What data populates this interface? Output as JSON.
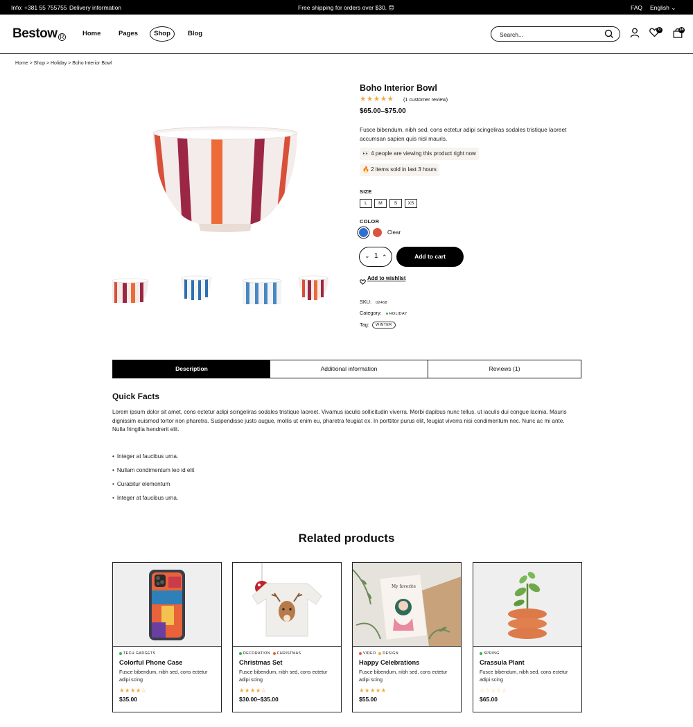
{
  "topbar": {
    "info": "Info: +381 55 755755",
    "delivery": "Delivery information",
    "shipping": "Free shipping for orders over $30. 😊",
    "faq": "FAQ",
    "language": "English ⌄"
  },
  "header": {
    "logo": "Bestow",
    "logo_mark": "R",
    "nav": [
      "Home",
      "Pages",
      "Shop",
      "Blog"
    ],
    "search_placeholder": "Search...",
    "wishlist_count": "0",
    "cart_count": "24"
  },
  "breadcrumb": "Home > Shop > Holiday > Boho Interior Bowl",
  "product": {
    "title": "Boho Interior Bowl",
    "stars": "★★★★★",
    "rating": 5,
    "review_text": "(1 customer review)",
    "price": "$65.00–$75.00",
    "description": "Fusce bibendum, nibh sed, cons ectetur adipi scingeliras sodales tristique laoreet accumsan sapien quis nisl mauris.",
    "viewing": "👀 4 people are viewing this product right now",
    "sold": "🔥 2 items sold in last 3 hours",
    "size_label": "SIZE",
    "sizes": [
      "L",
      "M",
      "S",
      "XS"
    ],
    "color_label": "COLOR",
    "colors": [
      "#2f6fd1",
      "#d9553d"
    ],
    "clear_label": "Clear",
    "quantity": "1",
    "add_to_cart": "Add to cart",
    "wishlist": "Add to wishlist",
    "sku_label": "SKU:",
    "sku": "02468",
    "category_label": "Category:",
    "category": "HOLIDAY",
    "tag_label": "Tag:",
    "tag": "WINTER"
  },
  "tabs": [
    "Description",
    "Additional information",
    "Reviews (1)"
  ],
  "quick_facts": {
    "title": "Quick Facts",
    "text": "Lorem ipsum dolor sit amet, cons ectetur adipi scingeliras sodales tristique laoreet. Vivamus iaculis sollicitudin viverra. Morbi dapibus nunc tellus, ut iaculis dui congue lacinia. Mauris dignissim euismod tortor non pharetra. Suspendisse justo augue, mollis ut enim eu, pharetra feugiat ex. In porttitor purus elit, feugiat viverra nisi condimentum nec. Nunc ac mi ante. Nulla fringilla hendrerit elit.",
    "bullets": [
      "Integer at faucibus urna.",
      "Nullam condimentum leo id elit",
      "Curabitur elementum",
      "Integer at faucibus urna."
    ]
  },
  "related": {
    "title": "Related products",
    "items": [
      {
        "cats": [
          "TECH GADGETS"
        ],
        "cat_colors": [
          "#3bb54a"
        ],
        "name": "Colorful Phone Case",
        "desc": "Fusce bibendum, nibh sed, cons ectetur adipi scing",
        "stars": "★★★★☆",
        "rating": 4,
        "price": "$35.00"
      },
      {
        "cats": [
          "DECORATION",
          "CHRISTMAS"
        ],
        "cat_colors": [
          "#3bb54a",
          "#e8623a"
        ],
        "name": "Christmas Set",
        "desc": "Fusce bibendum, nibh sed, cons ectetur adipi scing",
        "stars": "★★★★☆",
        "rating": 4,
        "price": "$30.00–$35.00"
      },
      {
        "cats": [
          "VIDEO",
          "DESIGN"
        ],
        "cat_colors": [
          "#e8623a",
          "#f2a93b"
        ],
        "name": "Happy Celebrations",
        "desc": "Fusce bibendum, nibh sed, cons ectetur adipi scing",
        "stars": "★★★★★",
        "rating": 5,
        "price": "$55.00"
      },
      {
        "cats": [
          "SPRING"
        ],
        "cat_colors": [
          "#3bb54a"
        ],
        "name": "Crassula Plant",
        "desc": "Fusce bibendum, nibh sed, cons ectetur adipi scing",
        "stars": "☆☆☆☆☆",
        "rating": 0,
        "price": "$65.00"
      }
    ]
  },
  "colors": {
    "star": "#f2a93b",
    "black": "#000000"
  }
}
